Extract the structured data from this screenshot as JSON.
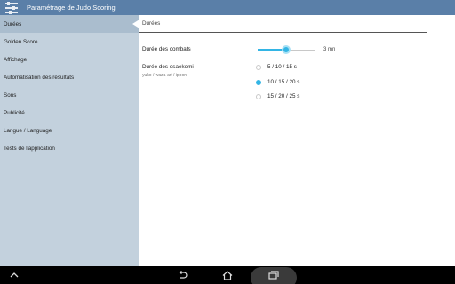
{
  "app": {
    "title": "Paramétrage de Judo Scoring",
    "icon": "settings-sliders-icon"
  },
  "sidebar": {
    "items": [
      {
        "label": "Durées",
        "active": true
      },
      {
        "label": "Golden Score",
        "active": false
      },
      {
        "label": "Affichage",
        "active": false
      },
      {
        "label": "Automatisation des résultats",
        "active": false
      },
      {
        "label": "Sons",
        "active": false
      },
      {
        "label": "Publicité",
        "active": false
      },
      {
        "label": "Langue / Language",
        "active": false
      },
      {
        "label": "Tests de l'application",
        "active": false
      }
    ]
  },
  "main": {
    "section_title": "Durées",
    "combat_duration": {
      "label": "Durée des combats",
      "value_text": "3 mn",
      "level": 0.5
    },
    "osaekomi": {
      "label": "Durée des osaekomi",
      "sublabel": "yuko / waza-ari / ippon",
      "options": [
        {
          "label": "5 / 10 / 15 s",
          "checked": false
        },
        {
          "label": "10 / 15 / 20 s",
          "checked": true
        },
        {
          "label": "15 / 20 / 25 s",
          "checked": false
        }
      ]
    }
  },
  "navbar": {
    "buttons": [
      "collapse-icon",
      "back-icon",
      "home-icon",
      "recent-apps-icon"
    ]
  },
  "colors": {
    "action_bar": "#5a7fa8",
    "sidebar": "#c3d1dd",
    "sidebar_active": "#aabdce",
    "accent": "#33b5e5"
  }
}
